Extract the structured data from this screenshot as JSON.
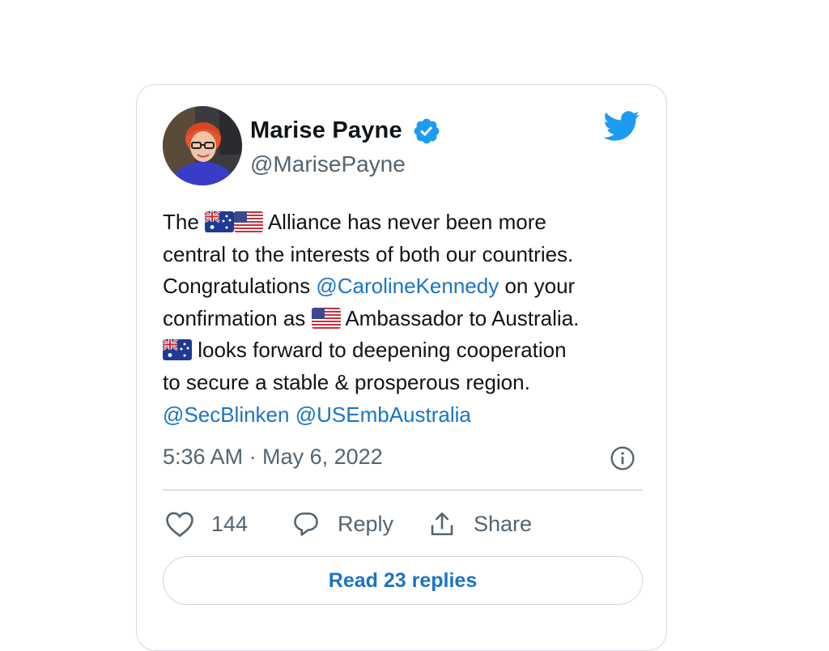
{
  "author": {
    "display_name": "Marise Payne",
    "handle": "@MarisePayne",
    "verified": true,
    "avatar_icon": "profile-photo"
  },
  "brand_icon": "twitter-bird-icon",
  "tweet": {
    "line1_pre": "The",
    "line1_post": "Alliance has never been more",
    "line2": "central to the interests of both our countries.",
    "line3_pre": "Congratulations",
    "line3_mention": "@CarolineKennedy",
    "line3_post": "on your",
    "line4_pre": "confirmation as",
    "line4_post": "Ambassador to Australia.",
    "line5_post": "looks forward to deepening cooperation",
    "line6": "to secure a stable & prosperous region.",
    "mention_1": "@SecBlinken",
    "mention_2": "@USEmbAustralia"
  },
  "timestamp": "5:36 AM · May 6, 2022",
  "actions": {
    "like_count": "144",
    "reply_label": "Reply",
    "share_label": "Share"
  },
  "read_replies_label": "Read 23 replies",
  "colors": {
    "accent": "#1b74c4",
    "twitter_blue": "#1d9bf0",
    "text": "#0f1419",
    "secondary_text": "#536471"
  }
}
